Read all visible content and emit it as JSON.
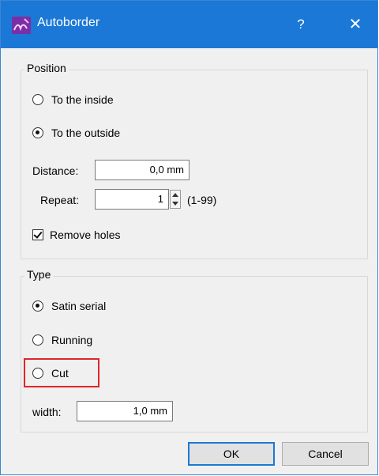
{
  "window": {
    "title": "Autoborder",
    "icon": "embroidery-app-icon",
    "help_label": "?",
    "close_label": "✕"
  },
  "position_group": {
    "legend": "Position",
    "options": [
      {
        "label": "To the inside",
        "selected": false
      },
      {
        "label": "To the outside",
        "selected": true
      }
    ],
    "distance": {
      "label": "Distance:",
      "value": "0,0 mm"
    },
    "repeat": {
      "label": "Repeat:",
      "value": "1",
      "range_hint": "(1-99)"
    },
    "remove_holes": {
      "label": "Remove holes",
      "checked": true
    }
  },
  "type_group": {
    "legend": "Type",
    "options": [
      {
        "label": "Satin serial",
        "selected": true
      },
      {
        "label": "Running",
        "selected": false
      },
      {
        "label": "Cut",
        "selected": false
      }
    ],
    "width": {
      "label": "width:",
      "value": "1,0 mm"
    }
  },
  "buttons": {
    "ok_label": "OK",
    "cancel_label": "Cancel"
  },
  "colors": {
    "titlebar": "#1b78d6",
    "dialog_bg": "#f0f0f0",
    "highlight": "#e0262a"
  }
}
